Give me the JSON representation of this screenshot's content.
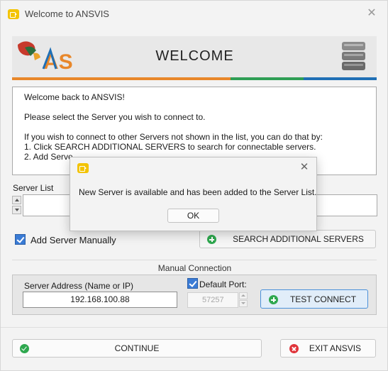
{
  "window": {
    "title": "Welcome to ANSVIS",
    "close_glyph": "✕"
  },
  "banner": {
    "title": "WELCOME",
    "logo_text": "AS",
    "stripe_colors": [
      "#e8872a",
      "#e8872a",
      "#e8872a",
      "#2f9e55",
      "#1f6fb5"
    ]
  },
  "message": {
    "line1": "Welcome back to ANSVIS!",
    "line2": "Please select the Server you wish to connect to.",
    "line3": "If you wish to connect to other Servers not shown in the list, you can do that by:",
    "line4": "1. Click SEARCH ADDITIONAL SERVERS to search for connectable servers.",
    "line5": "2. Add Serve"
  },
  "server_list": {
    "label": "Server List"
  },
  "add_manually": {
    "label": "Add Server Manually",
    "checked": true
  },
  "search_button": {
    "label": "SEARCH ADDITIONAL SERVERS",
    "icon": "plus-circle-icon"
  },
  "manual": {
    "title": "Manual Connection",
    "address_label": "Server Address (Name or IP)",
    "address_value": "192.168.100.88",
    "default_port_label": "Default Port:",
    "default_port_checked": true,
    "port_value": "57257",
    "test_button_label": "TEST CONNECT"
  },
  "footer": {
    "continue_label": "CONTINUE",
    "exit_label": "EXIT ANSVIS"
  },
  "dialog": {
    "message": "New Server is available and has been added to the Server List.",
    "ok_label": "OK",
    "close_glyph": "✕"
  },
  "colors": {
    "accent_blue": "#3a7bd5",
    "green": "#2fa84f",
    "red": "#e0353b",
    "app_icon_yellow": "#f3c300"
  }
}
